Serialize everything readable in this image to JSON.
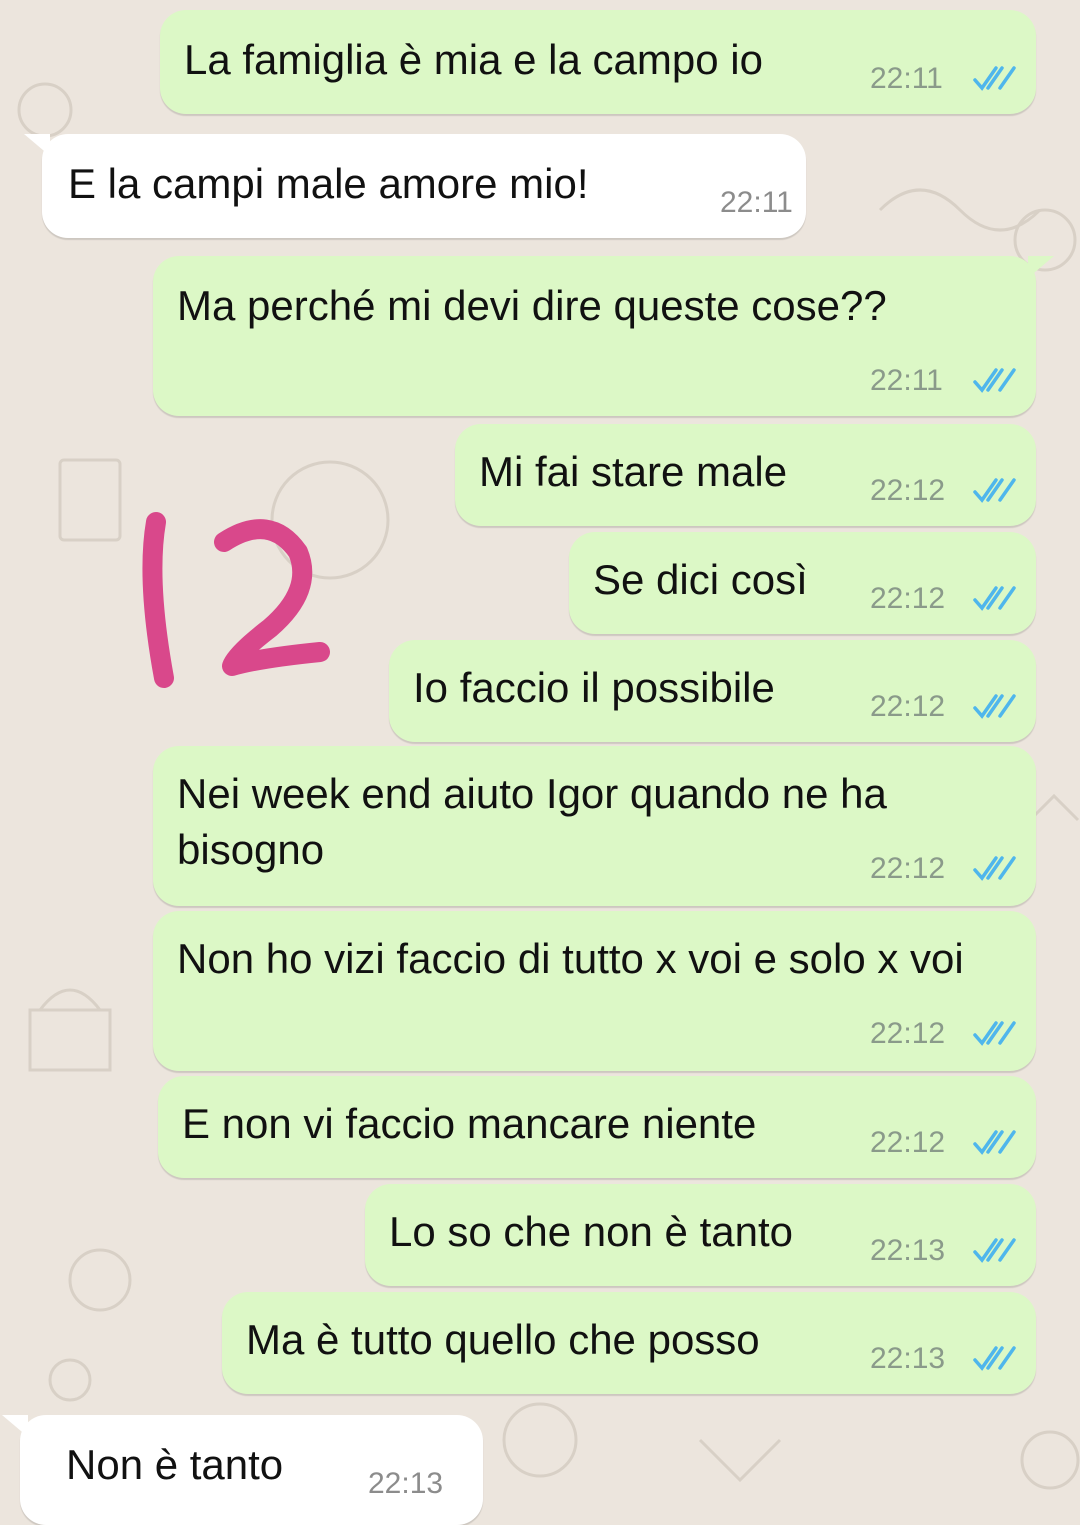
{
  "messages": [
    {
      "direction": "outgoing",
      "text": "La famiglia è mia e la campo io",
      "time": "22:11",
      "status": "read-double-check"
    },
    {
      "direction": "incoming",
      "text": "E la campi male amore mio!",
      "time": "22:11"
    },
    {
      "direction": "outgoing",
      "text": "Ma perché mi devi dire queste cose??",
      "time": "22:11",
      "status": "read-double-check"
    },
    {
      "direction": "outgoing",
      "text": "Mi fai stare male",
      "time": "22:12",
      "status": "read-double-check"
    },
    {
      "direction": "outgoing",
      "text": "Se dici così",
      "time": "22:12",
      "status": "read-double-check"
    },
    {
      "direction": "outgoing",
      "text": "Io faccio il possibile",
      "time": "22:12",
      "status": "read-double-check"
    },
    {
      "direction": "outgoing",
      "text": "Nei week end aiuto Igor quando ne ha bisogno",
      "time": "22:12",
      "status": "read-double-check"
    },
    {
      "direction": "outgoing",
      "text": "Non ho vizi faccio di tutto x voi e solo x voi",
      "time": "22:12",
      "status": "read-double-check"
    },
    {
      "direction": "outgoing",
      "text": "E non vi faccio mancare niente",
      "time": "22:12",
      "status": "read-double-check"
    },
    {
      "direction": "outgoing",
      "text": "Lo so che non è tanto",
      "time": "22:13",
      "status": "read-double-check"
    },
    {
      "direction": "outgoing",
      "text": "Ma è tutto quello che posso",
      "time": "22:13",
      "status": "read-double-check"
    },
    {
      "direction": "incoming",
      "text": "Non è tanto",
      "time": "22:13"
    }
  ],
  "annotation": {
    "text": "12",
    "color": "#d9488b",
    "kind": "handwritten-marker"
  },
  "colors": {
    "outgoing_bubble": "#dcf8c6",
    "incoming_bubble": "#ffffff",
    "background": "#ece5dd",
    "read_ticks": "#4fb6ec"
  }
}
